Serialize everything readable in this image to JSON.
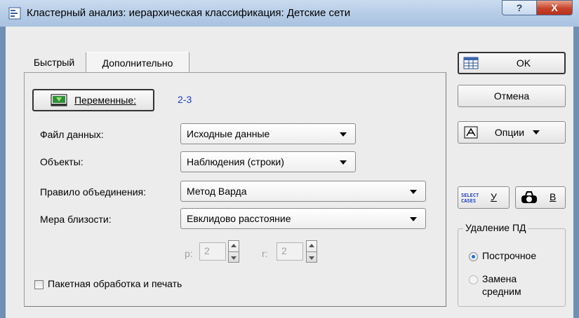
{
  "window": {
    "title": "Кластерный анализ: иерархическая классификация: Детские сети",
    "help_label": "?",
    "close_label": "X"
  },
  "tabs": [
    {
      "label": "Быстрый",
      "active": false
    },
    {
      "label": "Дополнительно",
      "active": true
    }
  ],
  "variables": {
    "button_label": "Переменные:",
    "value": "2-3"
  },
  "fields": {
    "data_file_label": "Файл данных:",
    "data_file_value": "Исходные данные",
    "objects_label": "Объекты:",
    "objects_value": "Наблюдения (строки)",
    "rule_label": "Правило объединения:",
    "rule_value": "Метод Варда",
    "measure_label": "Мера близости:",
    "measure_value": "Евклидово расстояние"
  },
  "spinners": {
    "p_label": "p:",
    "p_value": "2",
    "r_label": "r:",
    "r_value": "2"
  },
  "batch": {
    "label": "Пакетная обработка и печать",
    "checked": false
  },
  "buttons": {
    "ok": "OK",
    "cancel": "Отмена",
    "options": "Опции",
    "select_cases_line1": "SELECT",
    "select_cases_line2": "CASES",
    "select_cases_letter": "У",
    "b_letter": "В"
  },
  "missing": {
    "title": "Удаление ПД",
    "option1": "Построчное",
    "option2": "Замена средним",
    "selected": "Построчное"
  },
  "colors": {
    "accent_blue": "#1b3fbf",
    "close_red": "#c7432b"
  }
}
